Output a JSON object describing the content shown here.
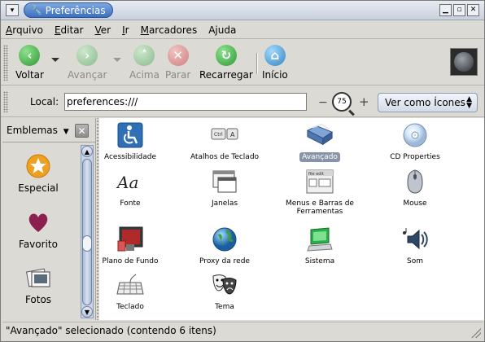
{
  "window": {
    "title": "Preferências",
    "menu_glyph": "▾",
    "minimize_glyph": "▁",
    "maximize_glyph": "▫",
    "close_glyph": "✕"
  },
  "menubar": {
    "items": [
      {
        "first": "A",
        "rest": "rquivo"
      },
      {
        "first": "E",
        "rest": "ditar"
      },
      {
        "first": "V",
        "rest": "er"
      },
      {
        "first": "I",
        "rest": "r"
      },
      {
        "first": "M",
        "rest": "arcadores"
      },
      {
        "first": "Aj",
        "rest": "uda",
        "underline_index": 2
      }
    ]
  },
  "toolbar": {
    "back": {
      "label": "Voltar",
      "icon": "back-arrow-icon",
      "glyph": "‹",
      "color": "#3bb143",
      "enabled": true
    },
    "forward": {
      "label": "Avançar",
      "icon": "forward-arrow-icon",
      "glyph": "›",
      "color": "#8bbf8e",
      "enabled": false
    },
    "up": {
      "label": "Acima",
      "icon": "up-arrow-icon",
      "glyph": "˄",
      "color": "#8bbf8e",
      "enabled": false
    },
    "stop": {
      "label": "Parar",
      "icon": "stop-icon",
      "glyph": "✕",
      "color": "#d98585",
      "enabled": false
    },
    "reload": {
      "label": "Recarregar",
      "icon": "reload-icon",
      "glyph": "↻",
      "color": "#3bb143",
      "enabled": true
    },
    "home": {
      "label": "Início",
      "icon": "home-icon",
      "glyph": "⌂",
      "color": "#3f9ad8",
      "enabled": true
    }
  },
  "location": {
    "label": "Local:",
    "value": "preferences:///",
    "zoom_minus": "−",
    "zoom_level": "75",
    "zoom_plus": "+",
    "view_mode": "Ver como Ícones"
  },
  "sidebar": {
    "selector_label": "Emblemas",
    "close_glyph": "✕",
    "emblems": [
      {
        "label": "Especial",
        "icon": "star-emblem-icon"
      },
      {
        "label": "Favorito",
        "icon": "heart-emblem-icon"
      },
      {
        "label": "Fotos",
        "icon": "photos-emblem-icon"
      }
    ]
  },
  "items": [
    {
      "label": "Acessibilidade",
      "icon": "accessibility-icon",
      "selected": false
    },
    {
      "label": "Atalhos de Teclado",
      "icon": "keyboard-shortcuts-icon",
      "selected": false
    },
    {
      "label": "Avançado",
      "icon": "advanced-folder-icon",
      "selected": true
    },
    {
      "label": "CD Properties",
      "icon": "cd-icon",
      "selected": false
    },
    {
      "label": "Fonte",
      "icon": "font-icon",
      "selected": false
    },
    {
      "label": "Janelas",
      "icon": "windows-icon",
      "selected": false
    },
    {
      "label": "Menus e Barras de Ferramentas",
      "icon": "menus-toolbars-icon",
      "selected": false
    },
    {
      "label": "Mouse",
      "icon": "mouse-icon",
      "selected": false
    },
    {
      "label": "Plano de Fundo",
      "icon": "background-icon",
      "selected": false
    },
    {
      "label": "Proxy da rede",
      "icon": "network-proxy-icon",
      "selected": false
    },
    {
      "label": "Sistema",
      "icon": "system-icon",
      "selected": false
    },
    {
      "label": "Som",
      "icon": "sound-icon",
      "selected": false
    },
    {
      "label": "Teclado",
      "icon": "keyboard-icon",
      "selected": false
    },
    {
      "label": "Tema",
      "icon": "theme-icon",
      "selected": false
    }
  ],
  "status": {
    "text": "\"Avançado\" selecionado (contendo 6 itens)"
  }
}
